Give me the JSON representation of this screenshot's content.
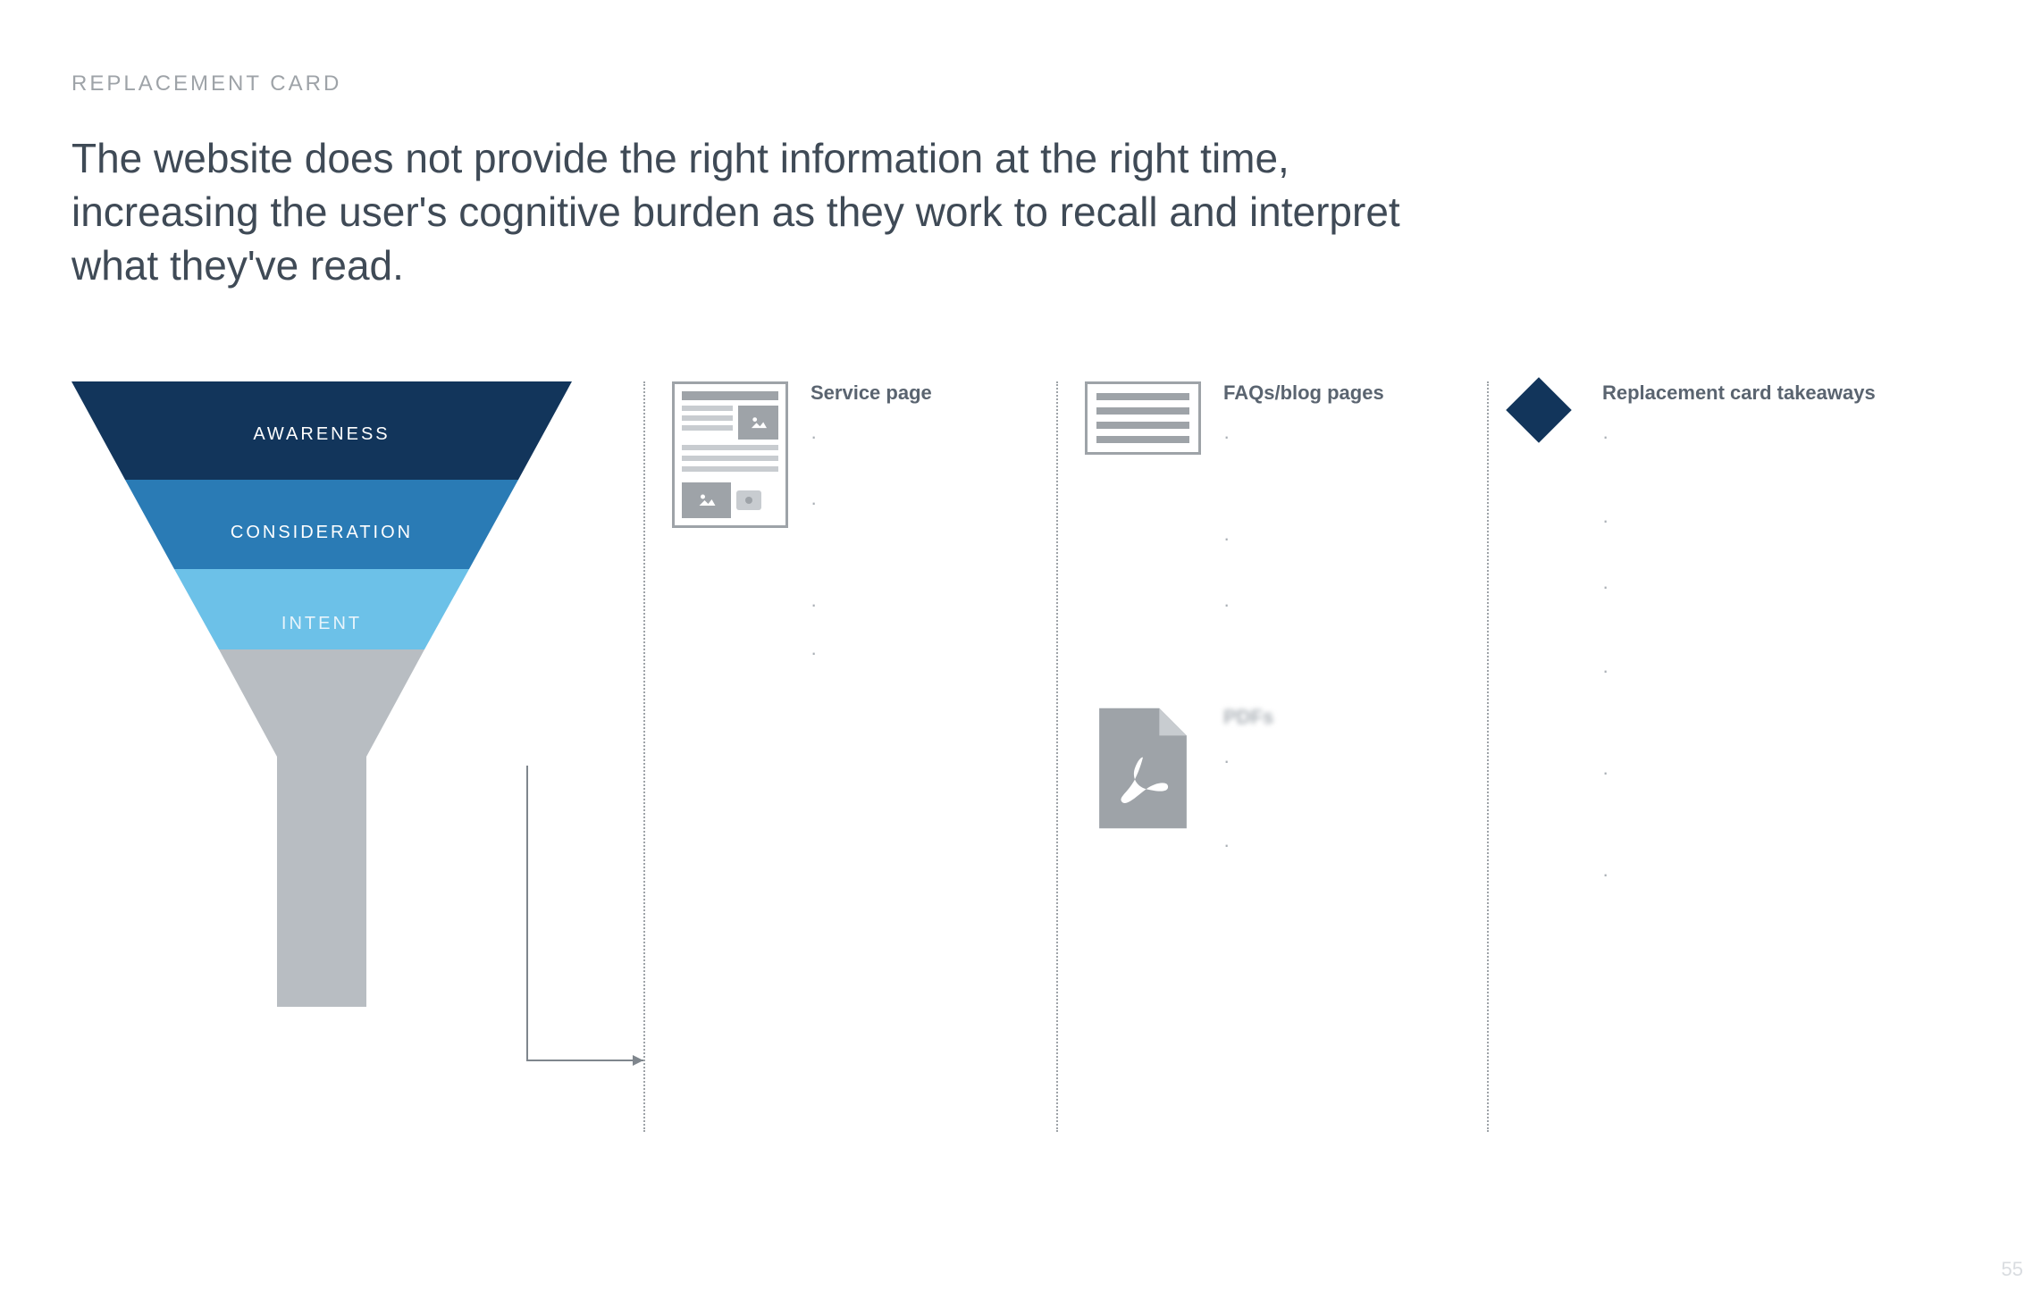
{
  "eyebrow": "REPLACEMENT CARD",
  "headline": "The website does not provide the right information at the right time, increasing the user's cognitive burden as they work to recall and interpret what they've read.",
  "funnel": {
    "levels": [
      {
        "label": "AWARENESS",
        "color": "#12355b"
      },
      {
        "label": "CONSIDERATION",
        "color": "#2a7bb5"
      },
      {
        "label": "INTENT",
        "color": "#6cc1e8"
      }
    ],
    "stem_color": "#b8bdc2"
  },
  "columns": {
    "service": {
      "heading": "Service page",
      "items": [
        3,
        5,
        2,
        8
      ]
    },
    "faq": {
      "heading": "FAQs/blog pages",
      "items": [
        5,
        3,
        4
      ]
    },
    "pdf": {
      "heading": "PDFs",
      "items": [
        4,
        5
      ]
    },
    "takeaways": {
      "heading": "Replacement card takeaways",
      "items": [
        4,
        3,
        4,
        5,
        5,
        3
      ]
    }
  },
  "page_number": "55"
}
